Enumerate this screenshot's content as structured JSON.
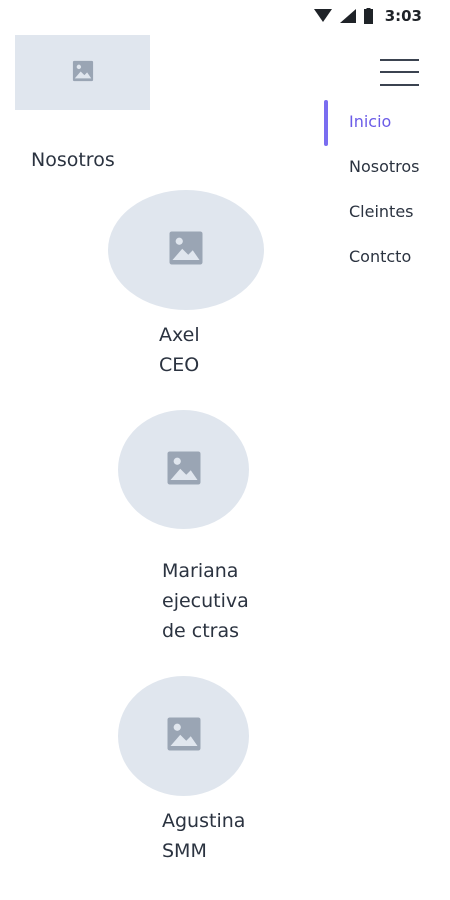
{
  "status_bar": {
    "time": "3:03",
    "icons": [
      "wifi-icon",
      "signal-icon",
      "battery-icon"
    ]
  },
  "header": {
    "logo_icon": "image-placeholder-icon",
    "menu_icon": "hamburger-menu-icon"
  },
  "nav": {
    "items": [
      {
        "label": "Inicio",
        "active": true
      },
      {
        "label": "Nosotros",
        "active": false
      },
      {
        "label": "Cleintes",
        "active": false
      },
      {
        "label": "Contcto",
        "active": false
      }
    ]
  },
  "section": {
    "title": "Nosotros"
  },
  "team": [
    {
      "name": "Axel",
      "role": "CEO",
      "role_line2": ""
    },
    {
      "name": "Mariana",
      "role": "ejecutiva",
      "role_line2": "de ctras"
    },
    {
      "name": "Agustina",
      "role": "SMM",
      "role_line2": ""
    }
  ],
  "colors": {
    "accent": "#6b5ce7",
    "placeholder_bg": "#e0e6ee",
    "placeholder_icon": "#9aa5b4",
    "text": "#2b3340"
  }
}
